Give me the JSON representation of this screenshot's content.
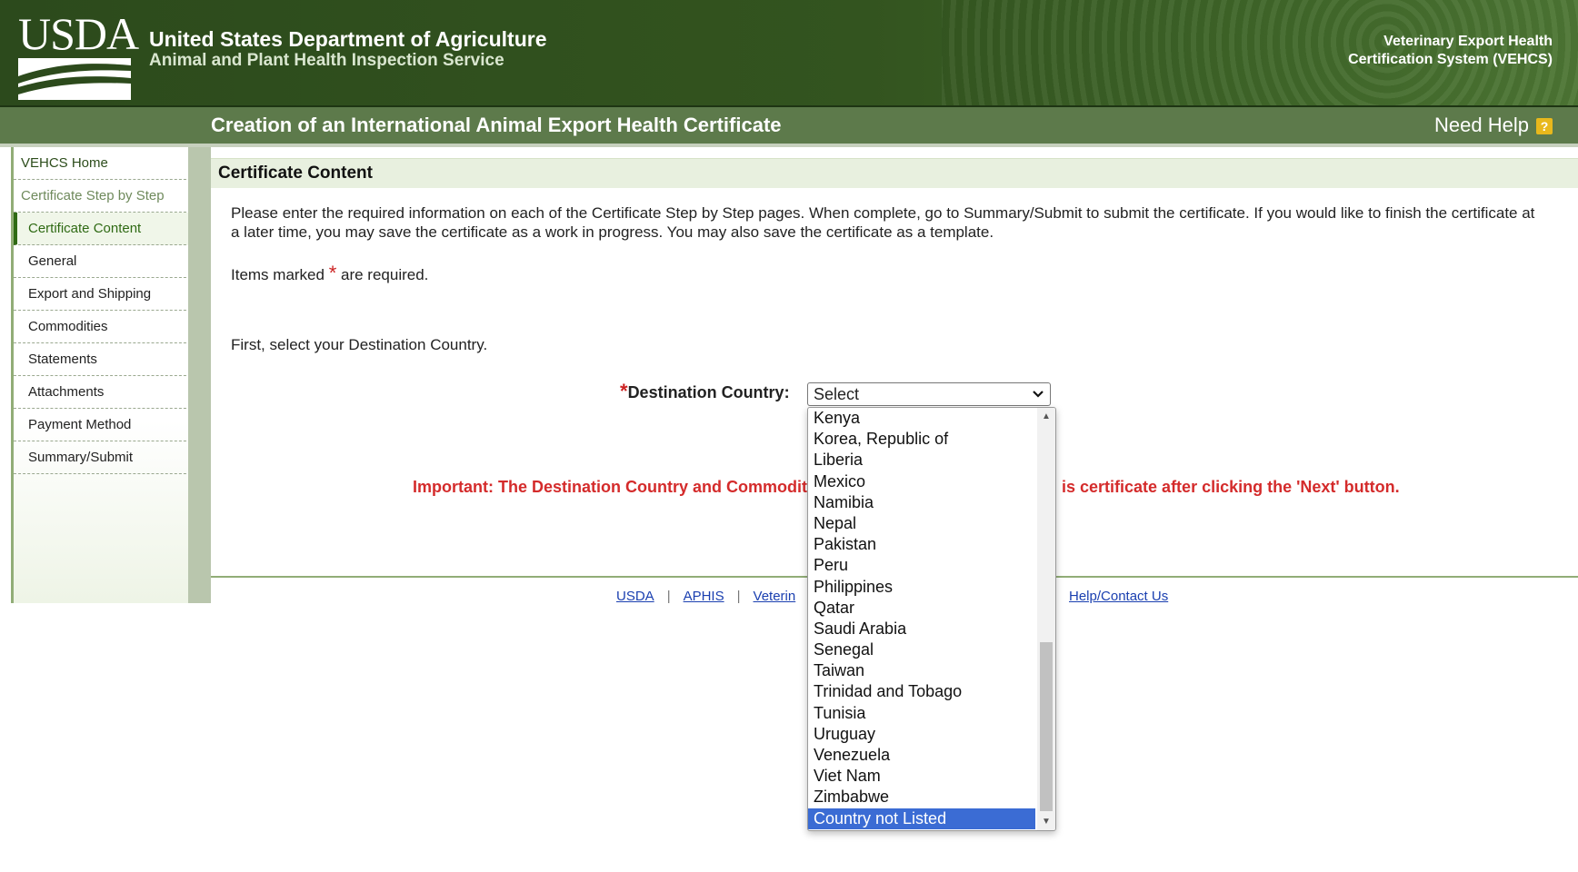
{
  "header": {
    "logo_text": "USDA",
    "agency_title": "United States Department of Agriculture",
    "agency_subtitle": "Animal and Plant Health Inspection Service",
    "system_name_line1": "Veterinary Export Health",
    "system_name_line2": "Certification System (VEHCS)"
  },
  "title_bar": {
    "title": "Creation of an International Animal Export Health Certificate",
    "need_help": "Need Help",
    "help_icon": "question-icon",
    "help_icon_glyph": "?"
  },
  "sidebar": {
    "items": [
      {
        "label": "VEHCS Home"
      },
      {
        "label": "Certificate Step by Step"
      },
      {
        "label": "Certificate Content"
      },
      {
        "label": "General"
      },
      {
        "label": "Export and Shipping"
      },
      {
        "label": "Commodities"
      },
      {
        "label": "Statements"
      },
      {
        "label": "Attachments"
      },
      {
        "label": "Payment Method"
      },
      {
        "label": "Summary/Submit"
      }
    ]
  },
  "content": {
    "section_title": "Certificate Content",
    "instructions": "Please enter the required information on each of the Certificate Step by Step pages. When complete, go to Summary/Submit to submit the certificate. If you would like to finish the certificate at a later time, you may save the certificate as a work in progress. You may also save the certificate as a template.",
    "required_prefix": "Items marked",
    "required_star": "*",
    "required_suffix": "are required.",
    "first_select": "First, select your Destination Country.",
    "dest_label": "Destination Country:",
    "dest_value": "Select",
    "important_left": "Important: The Destination Country and Commodity",
    "important_right": "is certificate after clicking the 'Next' button."
  },
  "dropdown": {
    "options": [
      "Kenya",
      "Korea, Republic of",
      "Liberia",
      "Mexico",
      "Namibia",
      "Nepal",
      "Pakistan",
      "Peru",
      "Philippines",
      "Qatar",
      "Saudi Arabia",
      "Senegal",
      "Taiwan",
      "Trinidad and Tobago",
      "Tunisia",
      "Uruguay",
      "Venezuela",
      "Viet Nam",
      "Zimbabwe",
      "Country not Listed"
    ],
    "highlighted": "Country not Listed"
  },
  "footer": {
    "links": [
      "USDA",
      "APHIS",
      "Veterin"
    ],
    "separator": "|",
    "help_link": "Help/Contact Us"
  },
  "colors": {
    "header_green": "#33541f",
    "title_bar_green": "#5d7a4b",
    "important_red": "#d42b2b",
    "link_blue": "#1a3fb0",
    "selected_blue": "#3b6cd4"
  }
}
